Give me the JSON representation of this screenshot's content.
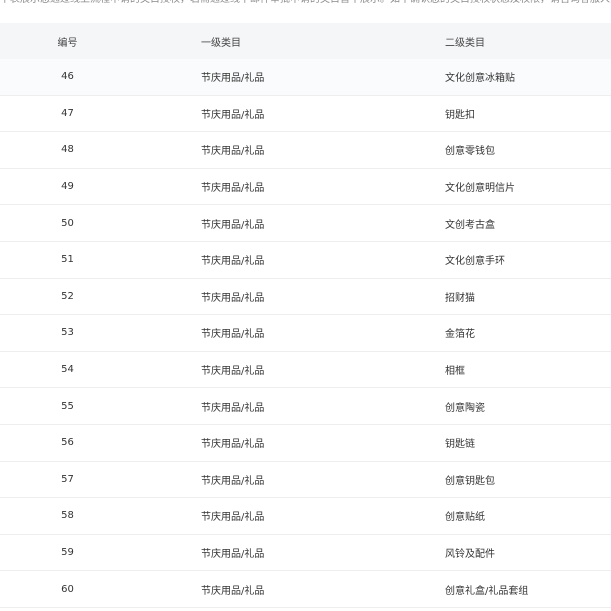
{
  "notice": "下表展示您通过线上流程申请的类目授权，若需通过线下邮件审批申请的类目暂不展示。如不确认您的类目授权状态及权限，请咨询客服人员。",
  "table": {
    "headers": [
      "编号",
      "一级类目",
      "二级类目"
    ],
    "rows": [
      {
        "id": "46",
        "primary": "节庆用品/礼品",
        "secondary": "文化创意冰箱贴"
      },
      {
        "id": "47",
        "primary": "节庆用品/礼品",
        "secondary": "钥匙扣"
      },
      {
        "id": "48",
        "primary": "节庆用品/礼品",
        "secondary": "创意零钱包"
      },
      {
        "id": "49",
        "primary": "节庆用品/礼品",
        "secondary": "文化创意明信片"
      },
      {
        "id": "50",
        "primary": "节庆用品/礼品",
        "secondary": "文创考古盒"
      },
      {
        "id": "51",
        "primary": "节庆用品/礼品",
        "secondary": "文化创意手环"
      },
      {
        "id": "52",
        "primary": "节庆用品/礼品",
        "secondary": "招财猫"
      },
      {
        "id": "53",
        "primary": "节庆用品/礼品",
        "secondary": "金箔花"
      },
      {
        "id": "54",
        "primary": "节庆用品/礼品",
        "secondary": "相框"
      },
      {
        "id": "55",
        "primary": "节庆用品/礼品",
        "secondary": "创意陶瓷"
      },
      {
        "id": "56",
        "primary": "节庆用品/礼品",
        "secondary": "钥匙链"
      },
      {
        "id": "57",
        "primary": "节庆用品/礼品",
        "secondary": "创意钥匙包"
      },
      {
        "id": "58",
        "primary": "节庆用品/礼品",
        "secondary": "创意贴纸"
      },
      {
        "id": "59",
        "primary": "节庆用品/礼品",
        "secondary": "风铃及配件"
      },
      {
        "id": "60",
        "primary": "节庆用品/礼品",
        "secondary": "创意礼盒/礼品套组"
      }
    ]
  }
}
